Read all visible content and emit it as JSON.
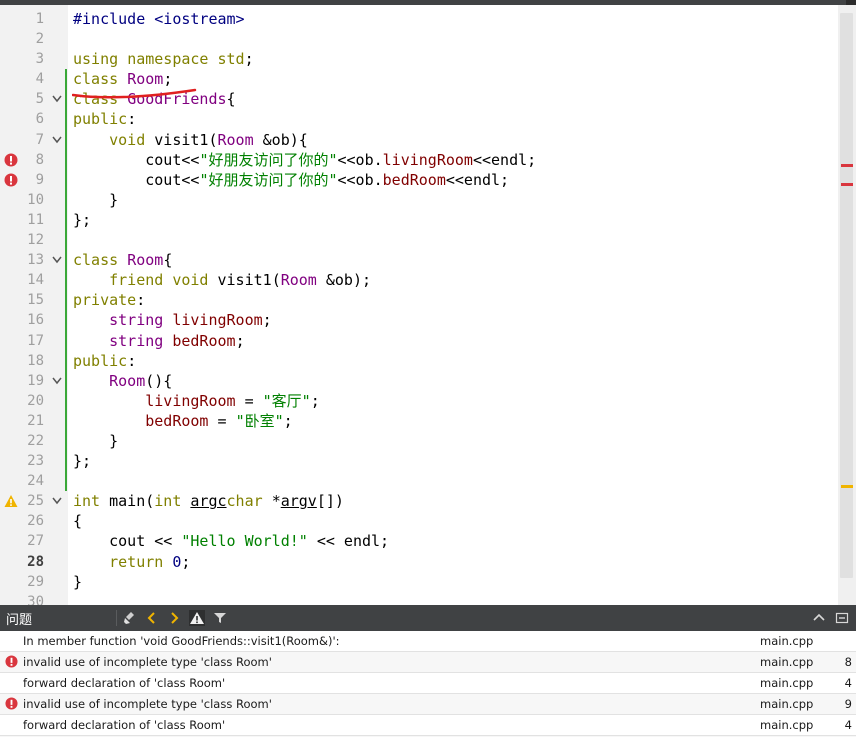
{
  "editor": {
    "lines": [
      {
        "n": "1",
        "tokens": [
          [
            "pp",
            "#include "
          ],
          [
            "pp",
            "<iostream>"
          ]
        ]
      },
      {
        "n": "2",
        "tokens": []
      },
      {
        "n": "3",
        "tokens": [
          [
            "kw",
            "using "
          ],
          [
            "kw",
            "namespace "
          ],
          [
            "kw",
            "std"
          ],
          [
            "",
            "; "
          ]
        ]
      },
      {
        "n": "4",
        "tokens": [
          [
            "kw",
            "class "
          ],
          [
            "ty",
            "Room"
          ],
          [
            "",
            ";"
          ]
        ],
        "change": true
      },
      {
        "n": "5",
        "tokens": [
          [
            "kw",
            "class "
          ],
          [
            "ty",
            "GoodFriends"
          ],
          [
            "",
            "{"
          ]
        ],
        "fold": true,
        "change": true
      },
      {
        "n": "6",
        "tokens": [
          [
            "kw",
            "public"
          ],
          [
            "",
            ":"
          ]
        ],
        "change": true
      },
      {
        "n": "7",
        "tokens": [
          [
            "",
            "    "
          ],
          [
            "kw",
            "void "
          ],
          [
            "fn",
            "visit1"
          ],
          [
            "",
            "("
          ],
          [
            "ty",
            "Room "
          ],
          [
            "",
            "&ob){"
          ]
        ],
        "fold": true,
        "change": true
      },
      {
        "n": "8",
        "tokens": [
          [
            "",
            "        cout<<"
          ],
          [
            "st",
            "\"好朋友访问了你的\""
          ],
          [
            "",
            "<<ob."
          ],
          [
            "mem",
            "livingRoom"
          ],
          [
            "",
            "<<endl;"
          ]
        ],
        "mark": "error",
        "change": true
      },
      {
        "n": "9",
        "tokens": [
          [
            "",
            "        cout<<"
          ],
          [
            "st",
            "\"好朋友访问了你的\""
          ],
          [
            "",
            "<<ob."
          ],
          [
            "mem",
            "bedRoom"
          ],
          [
            "",
            "<<endl;"
          ]
        ],
        "mark": "error",
        "change": true
      },
      {
        "n": "10",
        "tokens": [
          [
            "",
            "    }"
          ]
        ],
        "change": true
      },
      {
        "n": "11",
        "tokens": [
          [
            "",
            "};"
          ]
        ],
        "change": true
      },
      {
        "n": "12",
        "tokens": [],
        "change": true
      },
      {
        "n": "13",
        "tokens": [
          [
            "kw",
            "class "
          ],
          [
            "ty",
            "Room"
          ],
          [
            "",
            "{"
          ]
        ],
        "fold": true,
        "change": true
      },
      {
        "n": "14",
        "tokens": [
          [
            "",
            "    "
          ],
          [
            "kw",
            "friend "
          ],
          [
            "kw",
            "void "
          ],
          [
            "fn",
            "visit1"
          ],
          [
            "",
            "("
          ],
          [
            "ty",
            "Room "
          ],
          [
            "",
            "&ob);"
          ]
        ],
        "change": true
      },
      {
        "n": "15",
        "tokens": [
          [
            "kw",
            "private"
          ],
          [
            "",
            ":"
          ]
        ],
        "change": true
      },
      {
        "n": "16",
        "tokens": [
          [
            "",
            "    "
          ],
          [
            "ty",
            "string "
          ],
          [
            "mem",
            "livingRoom"
          ],
          [
            "",
            ";"
          ]
        ],
        "change": true
      },
      {
        "n": "17",
        "tokens": [
          [
            "",
            "    "
          ],
          [
            "ty",
            "string "
          ],
          [
            "mem",
            "bedRoom"
          ],
          [
            "",
            ";"
          ]
        ],
        "change": true
      },
      {
        "n": "18",
        "tokens": [
          [
            "kw",
            "public"
          ],
          [
            "",
            ":"
          ]
        ],
        "change": true
      },
      {
        "n": "19",
        "tokens": [
          [
            "",
            "    "
          ],
          [
            "ty",
            "Room"
          ],
          [
            "",
            "(){"
          ]
        ],
        "fold": true,
        "change": true
      },
      {
        "n": "20",
        "tokens": [
          [
            "",
            "        "
          ],
          [
            "mem",
            "livingRoom"
          ],
          [
            "",
            " = "
          ],
          [
            "st",
            "\"客厅\""
          ],
          [
            "",
            ";"
          ]
        ],
        "change": true
      },
      {
        "n": "21",
        "tokens": [
          [
            "",
            "        "
          ],
          [
            "mem",
            "bedRoom"
          ],
          [
            "",
            " = "
          ],
          [
            "st",
            "\"卧室\""
          ],
          [
            "",
            ";"
          ]
        ],
        "change": true
      },
      {
        "n": "22",
        "tokens": [
          [
            "",
            "    }"
          ]
        ],
        "change": true
      },
      {
        "n": "23",
        "tokens": [
          [
            "",
            "};"
          ]
        ],
        "change": true
      },
      {
        "n": "24",
        "tokens": [],
        "change": true
      },
      {
        "n": "25",
        "tokens": [
          [
            "kw",
            "int "
          ],
          [
            "fn",
            "main"
          ],
          [
            "",
            "("
          ],
          [
            "kw",
            "int "
          ],
          [
            "ul",
            "argc"
          ],
          [
            ", "
          ],
          [
            "kw",
            "char "
          ],
          [
            "",
            "*"
          ],
          [
            "ul",
            "argv"
          ],
          [
            "",
            "[])"
          ]
        ],
        "mark": "warning",
        "fold": true
      },
      {
        "n": "26",
        "tokens": [
          [
            "",
            "{"
          ]
        ]
      },
      {
        "n": "27",
        "tokens": [
          [
            "",
            "    cout << "
          ],
          [
            "st",
            "\"Hello World!\""
          ],
          [
            "",
            " << endl;"
          ]
        ]
      },
      {
        "n": "28",
        "tokens": [
          [
            "",
            "    "
          ],
          [
            "kw",
            "return "
          ],
          [
            "num-lit",
            "0"
          ],
          [
            "",
            ";"
          ]
        ],
        "current": true
      },
      {
        "n": "29",
        "tokens": [
          [
            "",
            "}"
          ]
        ]
      },
      {
        "n": "30",
        "tokens": []
      }
    ]
  },
  "issues_panel": {
    "title": "问题",
    "rows": [
      {
        "type": "info",
        "message": "In member function 'void GoodFriends::visit1(Room&)':",
        "file": "main.cpp",
        "line": ""
      },
      {
        "type": "error",
        "message": "invalid use of incomplete type 'class Room'",
        "file": "main.cpp",
        "line": "8"
      },
      {
        "type": "info",
        "message": "forward declaration of 'class Room'",
        "file": "main.cpp",
        "line": "4"
      },
      {
        "type": "error",
        "message": "invalid use of incomplete type 'class Room'",
        "file": "main.cpp",
        "line": "9"
      },
      {
        "type": "info",
        "message": "forward declaration of 'class Room'",
        "file": "main.cpp",
        "line": "4"
      },
      {
        "type": "info",
        "message": "",
        "file": "",
        "line": ""
      }
    ]
  },
  "colors": {
    "error": "#d9363e",
    "warning": "#f0b400",
    "change": "#3aa838",
    "annotation": "#e02020"
  }
}
